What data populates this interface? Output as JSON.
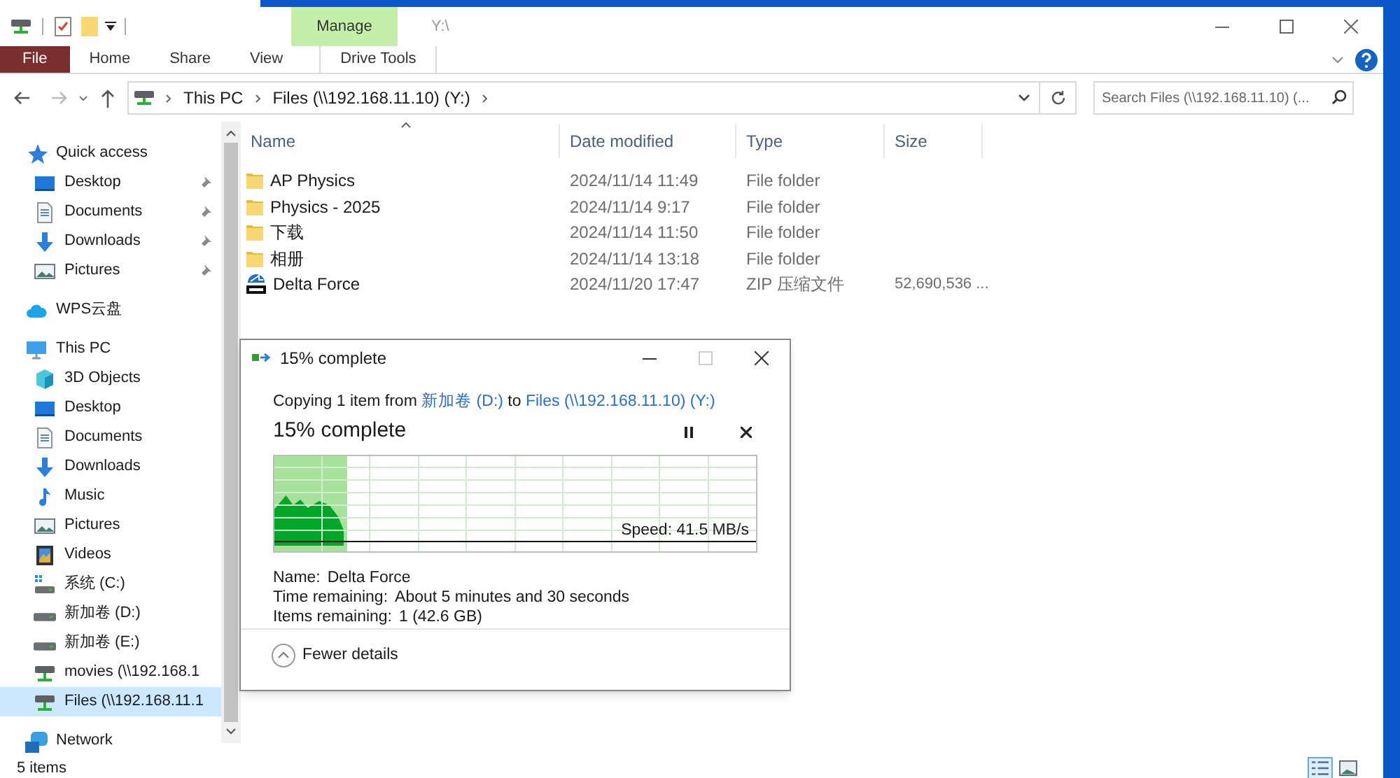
{
  "window": {
    "title": "Y:\\"
  },
  "ribbon": {
    "contextual_group": "Manage",
    "tabs": [
      {
        "label": "File",
        "kind": "file",
        "selected": false
      },
      {
        "label": "Home",
        "kind": "normal",
        "selected": false
      },
      {
        "label": "Share",
        "kind": "normal",
        "selected": false
      },
      {
        "label": "View",
        "kind": "normal",
        "selected": false
      },
      {
        "label": "Drive Tools",
        "kind": "contextual",
        "selected": false
      }
    ]
  },
  "address": {
    "crumbs": [
      "This PC",
      "Files (\\\\192.168.11.10) (Y:)"
    ]
  },
  "search": {
    "placeholder": "Search Files (\\\\192.168.11.10) (..."
  },
  "nav": [
    {
      "label": "Quick access",
      "kind": "star",
      "selected": false,
      "children": [
        {
          "label": "Desktop",
          "kind": "desktop",
          "pinned": true,
          "selected": false
        },
        {
          "label": "Documents",
          "kind": "document",
          "pinned": true,
          "selected": false
        },
        {
          "label": "Downloads",
          "kind": "download",
          "pinned": true,
          "selected": false
        },
        {
          "label": "Pictures",
          "kind": "pictures",
          "pinned": true,
          "selected": false
        }
      ]
    },
    {
      "label": "WPS云盘",
      "kind": "cloud",
      "selected": false
    },
    {
      "label": "This PC",
      "kind": "pc",
      "selected": false,
      "children": [
        {
          "label": "3D Objects",
          "kind": "cube",
          "selected": false
        },
        {
          "label": "Desktop",
          "kind": "desktop",
          "selected": false
        },
        {
          "label": "Documents",
          "kind": "document",
          "selected": false
        },
        {
          "label": "Downloads",
          "kind": "download",
          "selected": false
        },
        {
          "label": "Music",
          "kind": "music",
          "selected": false
        },
        {
          "label": "Pictures",
          "kind": "pictures",
          "selected": false
        },
        {
          "label": "Videos",
          "kind": "video",
          "selected": false
        },
        {
          "label": "系统 (C:)",
          "kind": "windrive",
          "selected": false
        },
        {
          "label": "新加卷 (D:)",
          "kind": "drive",
          "selected": false
        },
        {
          "label": "新加卷 (E:)",
          "kind": "drive",
          "selected": false
        },
        {
          "label": "movies (\\\\192.168.1",
          "kind": "netdrive",
          "selected": false
        },
        {
          "label": "Files (\\\\192.168.11.1",
          "kind": "netdrive",
          "selected": true
        }
      ]
    },
    {
      "label": "Network",
      "kind": "network",
      "selected": false
    }
  ],
  "table": {
    "columns": [
      {
        "label": "Name",
        "sorted": true
      },
      {
        "label": "Date modified",
        "sorted": false
      },
      {
        "label": "Type",
        "sorted": false
      },
      {
        "label": "Size",
        "sorted": false
      }
    ],
    "rows": [
      {
        "kind": "folder",
        "name": "AP Physics",
        "date": "2024/11/14 11:49",
        "type": "File folder"
      },
      {
        "kind": "folder",
        "name": "Physics - 2025",
        "date": "2024/11/14 9:17",
        "type": "File folder"
      },
      {
        "kind": "folder",
        "name": "下载",
        "date": "2024/11/14 11:50",
        "type": "File folder"
      },
      {
        "kind": "folder",
        "name": "相册",
        "date": "2024/11/14 13:18",
        "type": "File folder"
      },
      {
        "kind": "zip",
        "name": "Delta Force",
        "date": "2024/11/20 17:47",
        "type": "ZIP 压缩文件",
        "size": "52,690,536 ..."
      }
    ]
  },
  "status_bar": {
    "count": "5 items",
    "views": [
      {
        "kind": "details",
        "selected": true
      },
      {
        "kind": "large",
        "selected": false
      }
    ]
  },
  "dialog": {
    "title": "15% complete",
    "copy_line": {
      "prefix": "Copying 1 item from",
      "source": "新加卷 (D:)",
      "joiner": "to",
      "destination": "Files (\\\\192.168.11.10) (Y:)"
    },
    "heading": "15% complete",
    "level": 0.15,
    "speed": "Speed: 41.5 MB/s",
    "details": [
      {
        "label": "Name:",
        "value": "Delta Force"
      },
      {
        "label": "Time remaining:",
        "value": "About 5 minutes and 30 seconds"
      },
      {
        "label": "Items remaining:",
        "value": "1 (42.6 GB)"
      }
    ],
    "toggle": "Fewer details"
  }
}
